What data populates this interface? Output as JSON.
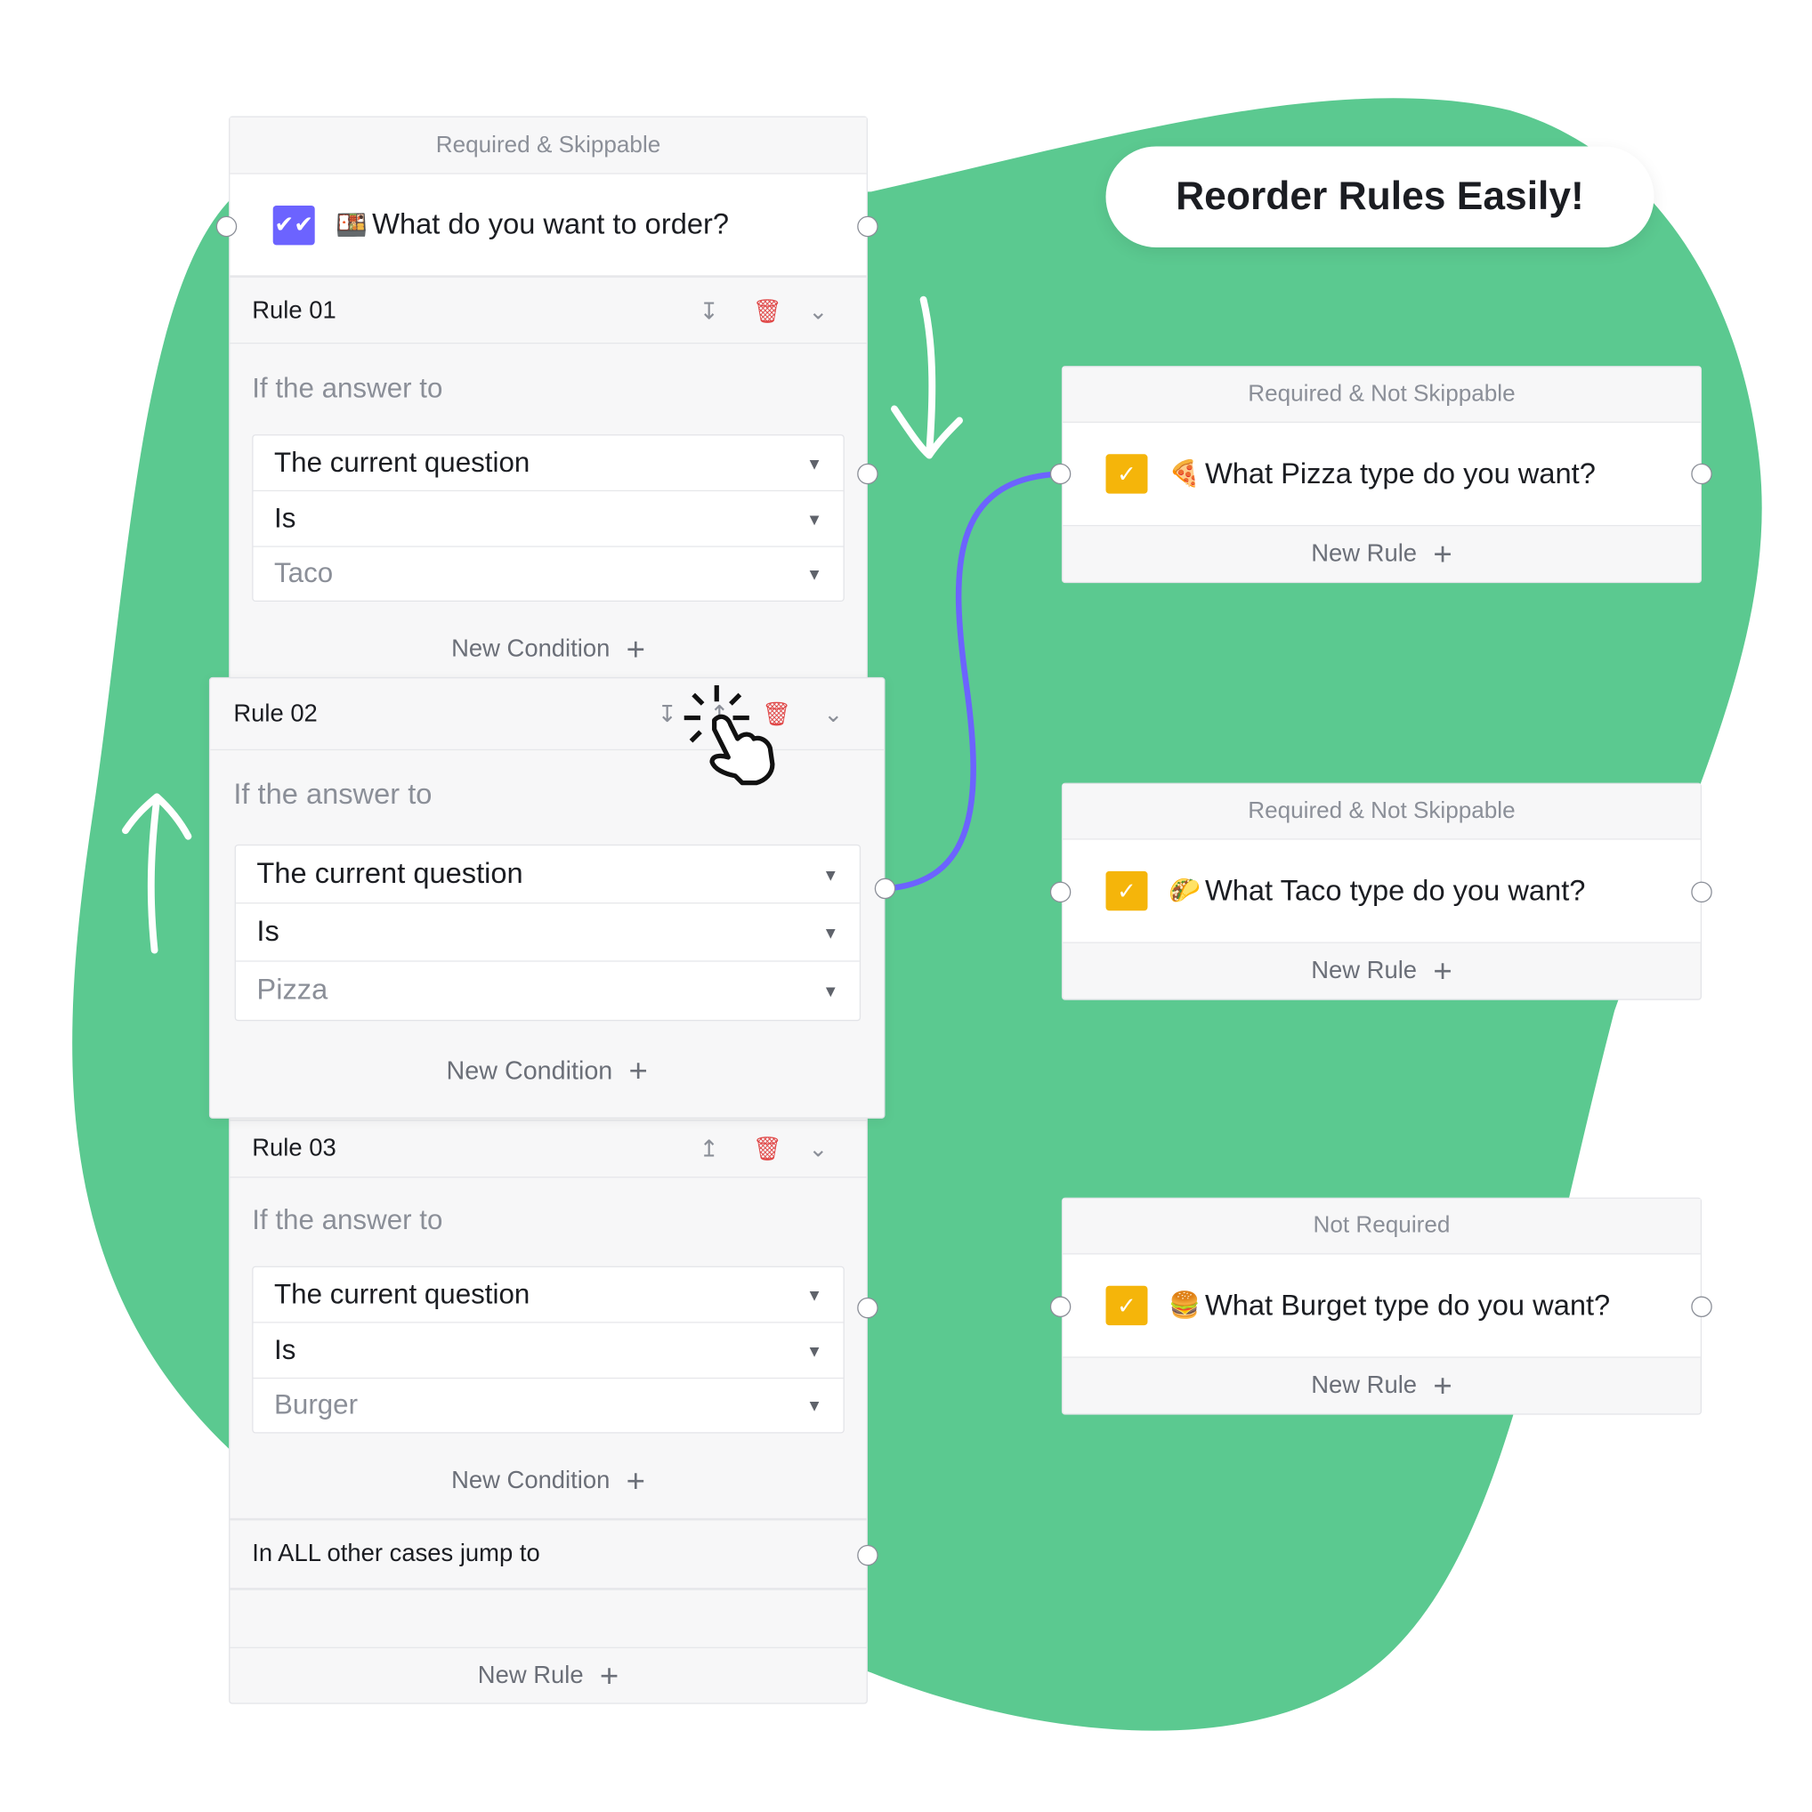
{
  "colors": {
    "blob": "#5BC990",
    "connector": "#6C63FF",
    "checkbox_main": "#6C63FF",
    "checkbox_sub": "#F5B50A",
    "delete": "#E04848"
  },
  "banner": {
    "text": "Reorder Rules Easily!"
  },
  "main_card": {
    "header": "Required & Skippable",
    "question": {
      "emoji": "🍱",
      "text": "What do you want to order?",
      "icon": "double-check-icon"
    },
    "rules": [
      {
        "title": "Rule 01",
        "if_label": "If the answer to",
        "conditions": [
          "The current question",
          "Is",
          "Taco"
        ],
        "new_condition": "New Condition",
        "move_icon": "move-down-icon"
      },
      {
        "title": "Rule 02",
        "if_label": "If the answer to",
        "conditions": [
          "The current question",
          "Is",
          "Pizza"
        ],
        "new_condition": "New Condition",
        "move_icon": "move-down-icon"
      },
      {
        "title": "Rule 03",
        "if_label": "If the answer to",
        "conditions": [
          "The current question",
          "Is",
          "Burger"
        ],
        "new_condition": "New Condition",
        "move_icon": "move-up-icon"
      }
    ],
    "other_cases": "In ALL other cases jump to",
    "new_rule": "New Rule",
    "plus": "+"
  },
  "targets": [
    {
      "header": "Required & Not Skippable",
      "emoji": "🍕",
      "question": "What Pizza type do you want?",
      "new_rule": "New Rule"
    },
    {
      "header": "Required & Not Skippable",
      "emoji": "🌮",
      "question": "What Taco type do you want?",
      "new_rule": "New Rule"
    },
    {
      "header": "Not Required",
      "emoji": "🍔",
      "question": "What Burget type do you want?",
      "new_rule": "New Rule"
    }
  ]
}
